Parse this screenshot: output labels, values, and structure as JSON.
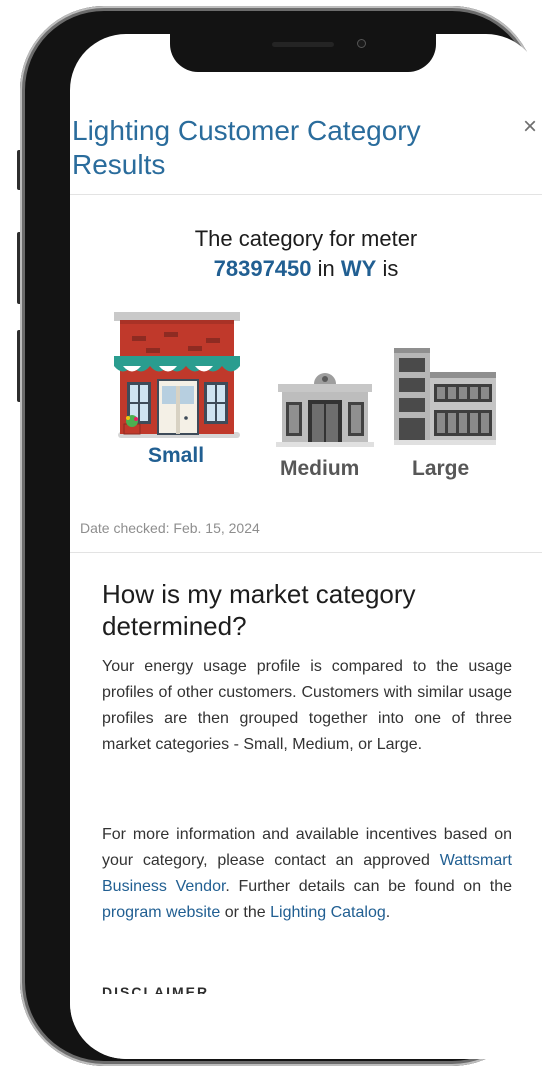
{
  "modal": {
    "title": "Lighting Customer Category Results",
    "close_label": "×"
  },
  "result": {
    "prefix": "The category for meter",
    "meter_number": "78397450",
    "in_word": "in",
    "state": "WY",
    "suffix": "is"
  },
  "categories": [
    {
      "label": "Small",
      "selected": true
    },
    {
      "label": "Medium",
      "selected": false
    },
    {
      "label": "Large",
      "selected": false
    }
  ],
  "date_checked": "Date checked: Feb. 15, 2024",
  "faq": {
    "heading": "How is my market category determined?",
    "paragraph1": "Your energy usage profile is compared to the usage profiles of other customers. Customers with similar usage profiles are then grouped together into one of three market categories - Small, Medium, or Large.",
    "paragraph2_part1": "For more information and available incentives based on your category, please contact an approved",
    "vendor_link": "Wattsmart Business Vendor",
    "paragraph2_part2": ". Further details can be found on the",
    "program_link": "program website",
    "paragraph2_part3": "or the",
    "catalog_link": "Lighting Catalog",
    "paragraph2_part4": ".",
    "disclaimer_heading": "DISCLAIMER"
  },
  "colors": {
    "title_blue": "#2a6c9c",
    "accent_blue": "#215f92",
    "text_dark": "#333333",
    "muted_gray": "#8e8e8e"
  }
}
